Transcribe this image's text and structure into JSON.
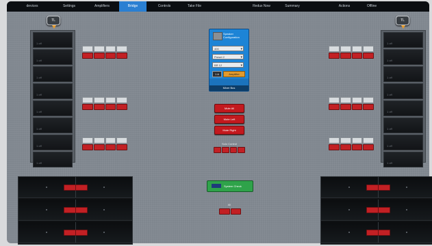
{
  "window": {
    "title": "Bridge"
  },
  "tabs": [
    {
      "label": "devices"
    },
    {
      "label": "Settings"
    },
    {
      "label": "Amplifiers"
    },
    {
      "label": "Bridge"
    },
    {
      "label": "Controls"
    },
    {
      "label": "Take File"
    },
    {
      "label": "Redux Now"
    },
    {
      "label": "Summary"
    },
    {
      "label": "Actions"
    },
    {
      "label": "Offline"
    }
  ],
  "speakers": {
    "left": "TL",
    "right": "TL"
  },
  "column_cells": [
    "1 off",
    "1 off",
    "1 off",
    "1 off",
    "1 off",
    "1 off",
    "1 off",
    "1 off",
    "1 off"
  ],
  "groups": {
    "top_buttons": [
      "",
      "",
      "",
      ""
    ],
    "red_buttons": [
      "",
      "",
      "",
      ""
    ]
  },
  "panel": {
    "title": "Speaker Configuration",
    "select1": "400",
    "select2": "Preset 2",
    "select3": "BR 12",
    "btn_small": "1 A",
    "btn_orange": "Amplifier",
    "footer": "Mixer Bus"
  },
  "center_buttons": [
    "Mute All",
    "Mute Left",
    "Mute Right"
  ],
  "center_label": "Solo Control",
  "green_button": "System Check",
  "bottom_label": "All",
  "colors": {
    "active_tab": "#2a7fd2",
    "red": "#c22024",
    "green": "#2fa34a",
    "orange": "#e39a2c"
  }
}
